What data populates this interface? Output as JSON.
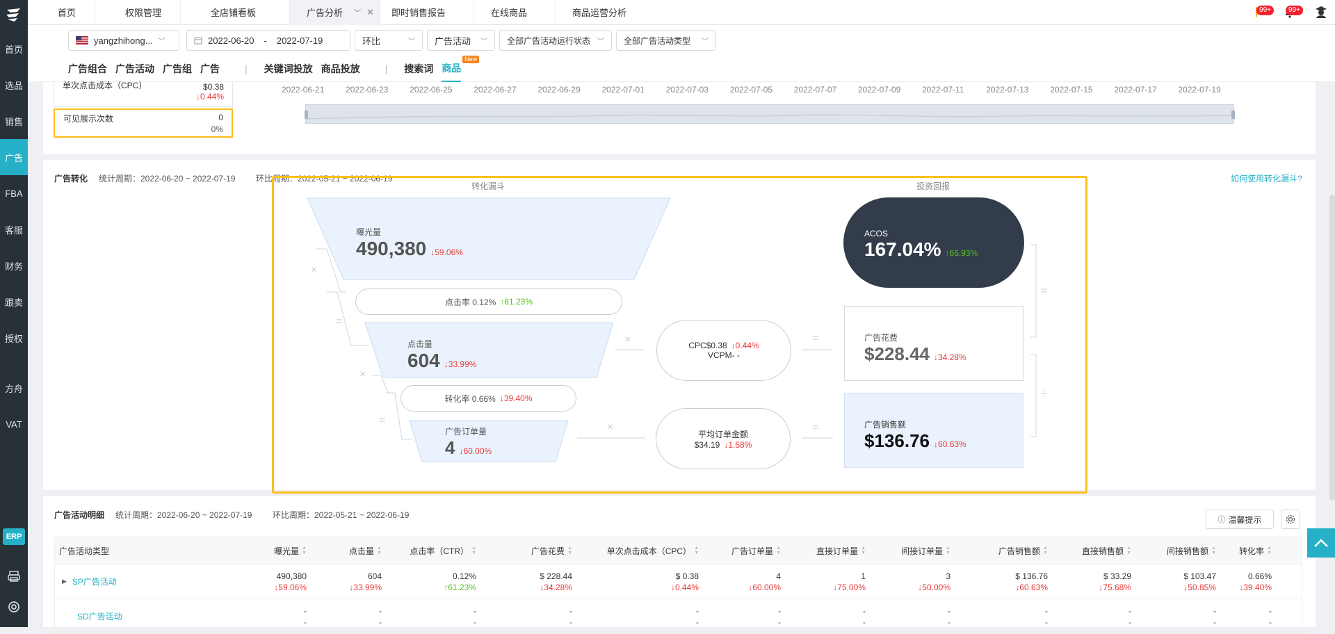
{
  "sidebar": {
    "items": [
      {
        "label": "首页"
      },
      {
        "label": "选品"
      },
      {
        "label": "销售"
      },
      {
        "label": "广告"
      },
      {
        "label": "FBA"
      },
      {
        "label": "客服"
      },
      {
        "label": "财务"
      },
      {
        "label": "跟卖"
      },
      {
        "label": "授权"
      },
      {
        "label": "方舟"
      },
      {
        "label": "VAT"
      }
    ],
    "erp_label": "ERP"
  },
  "tabs": [
    {
      "label": "首页"
    },
    {
      "label": "权限管理"
    },
    {
      "label": "全店铺看板"
    },
    {
      "label": "广告分析"
    },
    {
      "label": "即时销售报告"
    },
    {
      "label": "在线商品"
    },
    {
      "label": "商品运营分析"
    }
  ],
  "topright": {
    "flag_badge": "99+",
    "bell_badge": "99+"
  },
  "filters": {
    "account": "yangzhihong...",
    "date_start": "2022-06-20",
    "date_sep": "-",
    "date_end": "2022-07-19",
    "compare": "环比",
    "scope": "广告活动",
    "status": "全部广告活动运行状态",
    "type": "全部广告活动类型"
  },
  "subtabs": {
    "group1": [
      "广告组合",
      "广告活动",
      "广告组",
      "广告"
    ],
    "group2": [
      "关键词投放",
      "商品投放"
    ],
    "group3": [
      "搜索词",
      "商品"
    ],
    "new_tag": "New"
  },
  "metrics": {
    "cpc_label": "单次点击成本（CPC）",
    "cpc_value": "$0.38",
    "cpc_change": "↓0.44%",
    "visible_label": "可见展示次数",
    "visible_value": "0",
    "visible_change": "0%"
  },
  "timeline": {
    "dates": [
      "2022-06-21",
      "2022-06-23",
      "2022-06-25",
      "2022-06-27",
      "2022-06-29",
      "2022-07-01",
      "2022-07-03",
      "2022-07-05",
      "2022-07-07",
      "2022-07-09",
      "2022-07-11",
      "2022-07-13",
      "2022-07-15",
      "2022-07-17",
      "2022-07-19"
    ]
  },
  "conversion": {
    "title": "广告转化",
    "period": "统计周期：2022-06-20 ~ 2022-07-19",
    "compare_period": "环比周期：2022-05-21 ~ 2022-06-19",
    "funnel_title": "转化漏斗",
    "roi_title": "投资回报",
    "help_link": "如何使用转化漏斗?",
    "impressions_label": "曝光量",
    "impressions_value": "490,380",
    "impressions_change": "↓59.06%",
    "ctr_label": "点击率 0.12%",
    "ctr_change": "↑61.23%",
    "clicks_label": "点击量",
    "clicks_value": "604",
    "clicks_change": "↓33.99%",
    "cvr_label": "转化率 0.66%",
    "cvr_change": "↓39.40%",
    "orders_label": "广告订单量",
    "orders_value": "4",
    "orders_change": "↓60.00%",
    "cpc_text": "CPC$0.38",
    "cpc_change": "↓0.44%",
    "vcpm_text": "VCPM-  -",
    "aov_label": "平均订单金额",
    "aov_value": "$34.19",
    "aov_change": "↓1.58%",
    "acos_label": "ACOS",
    "acos_value": "167.04%",
    "acos_change": "↑66.93%",
    "spend_label": "广告花费",
    "spend_value": "$228.44",
    "spend_change": "↓34.28%",
    "sales_label": "广告销售额",
    "sales_value": "$136.76",
    "sales_change": "↓60.63%",
    "op_times": "×",
    "op_eq": "=",
    "op_div": "÷"
  },
  "detail": {
    "title": "广告活动明细",
    "period": "统计周期：2022-06-20 ~ 2022-07-19",
    "compare_period": "环比周期：2022-05-21 ~ 2022-06-19",
    "tip_button": "温馨提示",
    "columns": [
      "广告活动类型",
      "曝光量",
      "点击量",
      "点击率（CTR）",
      "广告花费",
      "单次点击成本（CPC）",
      "广告订单量",
      "直接订单量",
      "间接订单量",
      "广告销售额",
      "直接销售额",
      "间接销售额",
      "转化率"
    ],
    "rows": [
      {
        "name": "SP广告活动",
        "cells": [
          [
            "490,380",
            "↓59.06%"
          ],
          [
            "604",
            "↓33.99%"
          ],
          [
            "0.12%",
            "↑61.23%"
          ],
          [
            "$ 228.44",
            "↓34.28%"
          ],
          [
            "$ 0.38",
            "↓0.44%"
          ],
          [
            "4",
            "↓60.00%"
          ],
          [
            "1",
            "↓75.00%"
          ],
          [
            "3",
            "↓50.00%"
          ],
          [
            "$ 136.76",
            "↓60.63%"
          ],
          [
            "$ 33.29",
            "↓75.68%"
          ],
          [
            "$ 103.47",
            "↓50.85%"
          ],
          [
            "0.66%",
            "↓39.40%"
          ]
        ]
      },
      {
        "name": "SD广告活动",
        "cells": [
          [
            "-",
            "-"
          ],
          [
            "-",
            "-"
          ],
          [
            "-",
            "-"
          ],
          [
            "-",
            "-"
          ],
          [
            "-",
            "-"
          ],
          [
            "-",
            "-"
          ],
          [
            "-",
            "-"
          ],
          [
            "-",
            "-"
          ],
          [
            "-",
            "-"
          ],
          [
            "-",
            "-"
          ],
          [
            "-",
            "-"
          ],
          [
            "-",
            "-"
          ]
        ]
      }
    ]
  }
}
